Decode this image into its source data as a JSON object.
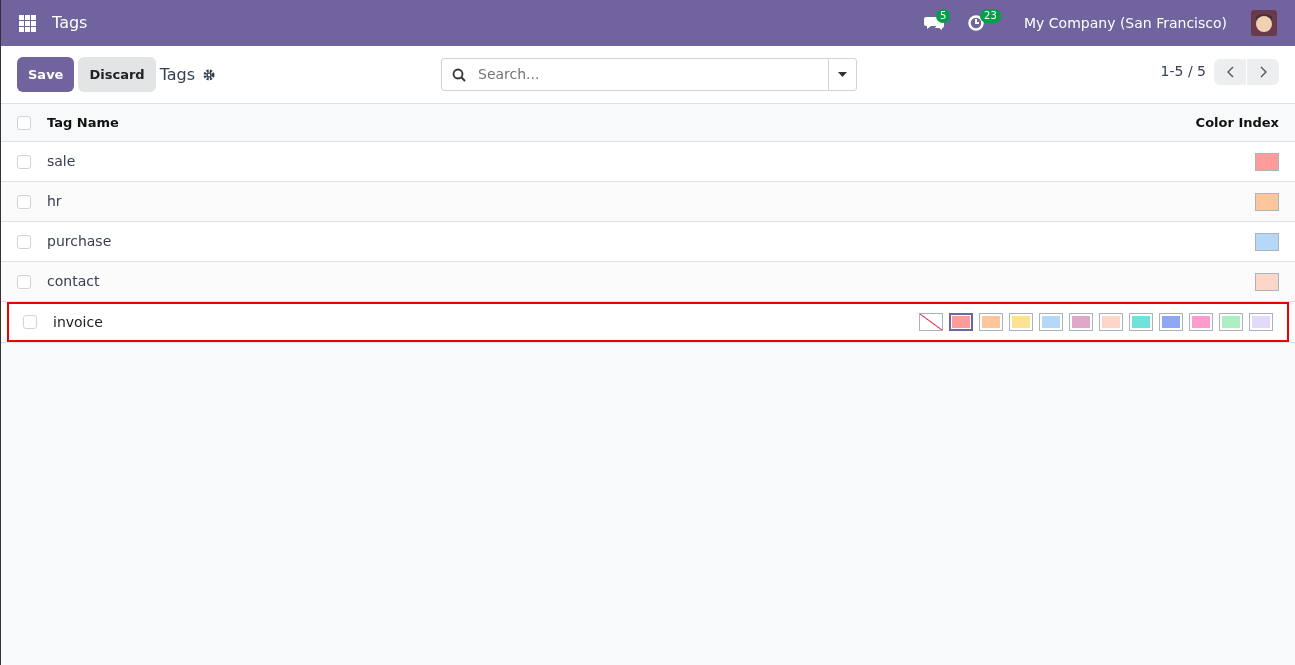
{
  "navbar": {
    "title": "Tags",
    "messages_count": "5",
    "activities_count": "23",
    "company": "My Company (San Francisco)"
  },
  "control_panel": {
    "save": "Save",
    "discard": "Discard",
    "breadcrumb": "Tags",
    "search_placeholder": "Search...",
    "pager": "1-5 / 5"
  },
  "table": {
    "all_checked": false,
    "columns": [
      "Tag Name",
      "Color Index"
    ],
    "rows": [
      {
        "kind": "display",
        "name": "sale",
        "color": "#ff9b9b",
        "checked": false
      },
      {
        "kind": "display",
        "name": "hr",
        "color": "#ffc69d",
        "checked": false
      },
      {
        "kind": "display",
        "name": "purchase",
        "color": "#b5d8f6",
        "checked": false
      },
      {
        "kind": "display",
        "name": "contact",
        "color": "#fdd6ca",
        "checked": false
      },
      {
        "kind": "editing",
        "name": "invoice",
        "checked": false,
        "palette": [
          {
            "kind": "none",
            "selected": false
          },
          {
            "kind": "swatch",
            "color": "#ff9b9b",
            "selected": true
          },
          {
            "kind": "swatch",
            "color": "#ffc69d",
            "selected": false
          },
          {
            "kind": "swatch",
            "color": "#fee293",
            "selected": false
          },
          {
            "kind": "swatch",
            "color": "#b5d8f6",
            "selected": false
          },
          {
            "kind": "swatch",
            "color": "#e0a7c8",
            "selected": false
          },
          {
            "kind": "swatch",
            "color": "#fdd6ca",
            "selected": false
          },
          {
            "kind": "swatch",
            "color": "#6fe2dc",
            "selected": false
          },
          {
            "kind": "swatch",
            "color": "#8fa7f2",
            "selected": false
          },
          {
            "kind": "swatch",
            "color": "#ff9ccd",
            "selected": false
          },
          {
            "kind": "swatch",
            "color": "#aeeec4",
            "selected": false
          },
          {
            "kind": "swatch",
            "color": "#e3daf9",
            "selected": false
          }
        ]
      }
    ]
  }
}
